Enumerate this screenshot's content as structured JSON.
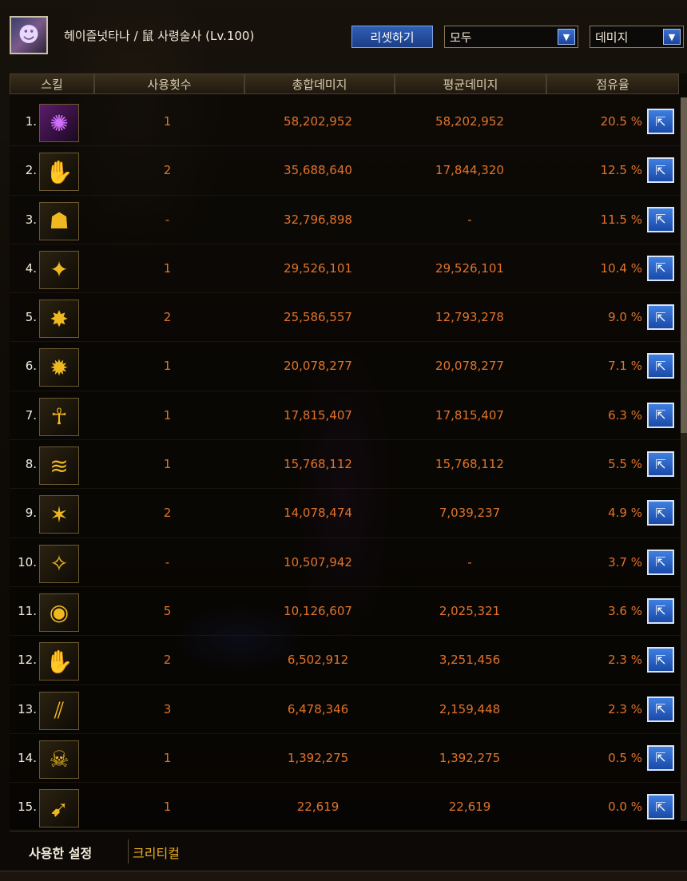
{
  "header": {
    "character_name": "헤이즐넛타나 / 鼠 사령술사 (Lv.100)",
    "reset_label": "리셋하기",
    "filter_select": "모두",
    "type_select": "데미지"
  },
  "table": {
    "columns": [
      "스킬",
      "사용횟수",
      "총합데미지",
      "평균데미지",
      "점유율"
    ],
    "rows": [
      {
        "rank": "1.",
        "uses": "1",
        "total": "58,202,952",
        "average": "58,202,952",
        "share": "20.5 %",
        "icon": "purple-demon-skill-icon"
      },
      {
        "rank": "2.",
        "uses": "2",
        "total": "35,688,640",
        "average": "17,844,320",
        "share": "12.5 %",
        "icon": "claw-burst-skill-icon"
      },
      {
        "rank": "3.",
        "uses": "-",
        "total": "32,796,898",
        "average": "-",
        "share": "11.5 %",
        "icon": "mask-skill-icon"
      },
      {
        "rank": "4.",
        "uses": "1",
        "total": "29,526,101",
        "average": "29,526,101",
        "share": "10.4 %",
        "icon": "dragon-claw-skill-icon"
      },
      {
        "rank": "5.",
        "uses": "2",
        "total": "25,586,557",
        "average": "12,793,278",
        "share": "9.0 %",
        "icon": "beast-swarm-skill-icon"
      },
      {
        "rank": "6.",
        "uses": "1",
        "total": "20,078,277",
        "average": "20,078,277",
        "share": "7.1 %",
        "icon": "dark-beast-skill-icon"
      },
      {
        "rank": "7.",
        "uses": "1",
        "total": "17,815,407",
        "average": "17,815,407",
        "share": "6.3 %",
        "icon": "spirit-woman-skill-icon"
      },
      {
        "rank": "8.",
        "uses": "1",
        "total": "15,768,112",
        "average": "15,768,112",
        "share": "5.5 %",
        "icon": "slash-wave-skill-icon"
      },
      {
        "rank": "9.",
        "uses": "2",
        "total": "14,078,474",
        "average": "7,039,237",
        "share": "4.9 %",
        "icon": "spike-burst-skill-icon"
      },
      {
        "rank": "10.",
        "uses": "-",
        "total": "10,507,942",
        "average": "-",
        "share": "3.7 %",
        "icon": "wing-head-skill-icon"
      },
      {
        "rank": "11.",
        "uses": "5",
        "total": "10,126,607",
        "average": "2,025,321",
        "share": "3.6 %",
        "icon": "fire-orb-skill-icon"
      },
      {
        "rank": "12.",
        "uses": "2",
        "total": "6,502,912",
        "average": "3,251,456",
        "share": "2.3 %",
        "icon": "hand-grab-skill-icon"
      },
      {
        "rank": "13.",
        "uses": "3",
        "total": "6,478,346",
        "average": "2,159,448",
        "share": "2.3 %",
        "icon": "triple-claw-skill-icon"
      },
      {
        "rank": "14.",
        "uses": "1",
        "total": "1,392,275",
        "average": "1,392,275",
        "share": "0.5 %",
        "icon": "skull-skill-icon"
      },
      {
        "rank": "15.",
        "uses": "1",
        "total": "22,619",
        "average": "22,619",
        "share": "0.0 %",
        "icon": "kunai-skill-icon"
      }
    ]
  },
  "tabs": {
    "used_settings": "사용한 설정",
    "critical": "크리티컬"
  },
  "colors": {
    "value_orange": "#e2732a",
    "button_blue": "#2f5fb5",
    "critical_tab": "#f0b020"
  }
}
